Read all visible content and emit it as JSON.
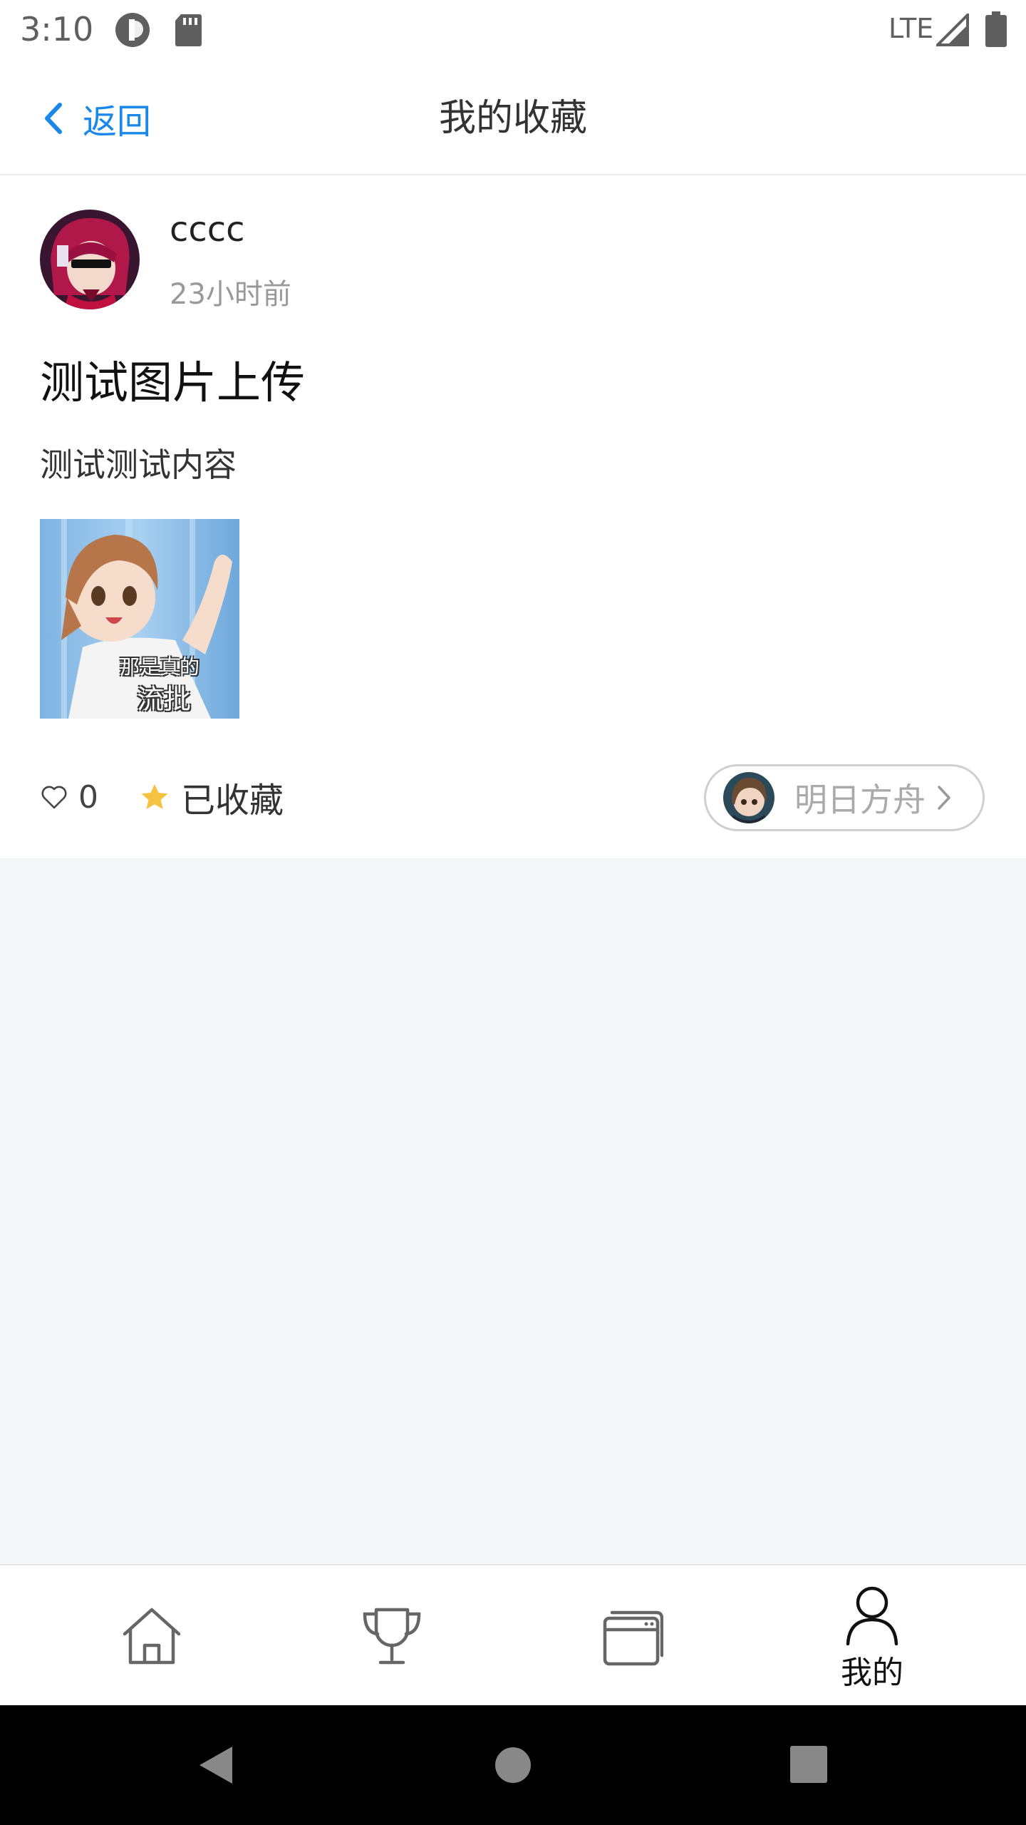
{
  "status_bar": {
    "time": "3:10",
    "network": "LTE"
  },
  "nav": {
    "back_label": "返回",
    "title": "我的收藏"
  },
  "post": {
    "username": "cccc",
    "time_ago": "23小时前",
    "title": "测试图片上传",
    "content": "测试测试内容",
    "image_caption_line1": "那是真的",
    "image_caption_line2": "流批",
    "like_count": "0",
    "favorite_label": "已收藏",
    "topic_label": "明日方舟"
  },
  "tabbar": {
    "items": [
      {
        "icon": "home-icon",
        "label": ""
      },
      {
        "icon": "trophy-icon",
        "label": ""
      },
      {
        "icon": "cards-icon",
        "label": ""
      },
      {
        "icon": "person-icon",
        "label": "我的"
      }
    ],
    "active_index": 3
  },
  "colors": {
    "accent": "#1a88e8",
    "star": "#f5c242",
    "page_bg": "#f5f6f8"
  }
}
